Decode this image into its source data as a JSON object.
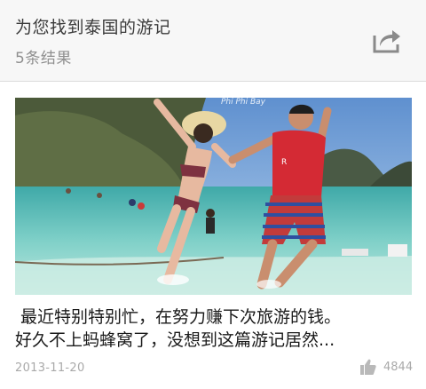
{
  "header": {
    "title": "为您找到泰国的游记",
    "result_count": "5条结果",
    "share_icon": "share-icon"
  },
  "result": {
    "photo_watermark": "Phi Phi Bay",
    "excerpt_line1": "最近特别特别忙，在努力赚下次旅游的钱。",
    "excerpt_line2": "好久不上蚂蜂窝了，没想到这篇游记居然...",
    "date": "2013-11-20",
    "like_icon": "thumbs-up-icon",
    "like_count": "4844"
  },
  "colors": {
    "header_bg": "#f7f7f7",
    "meta_gray": "#a9a9a9",
    "sky": "#7aa6d6",
    "sea": "#6fc3c0"
  }
}
